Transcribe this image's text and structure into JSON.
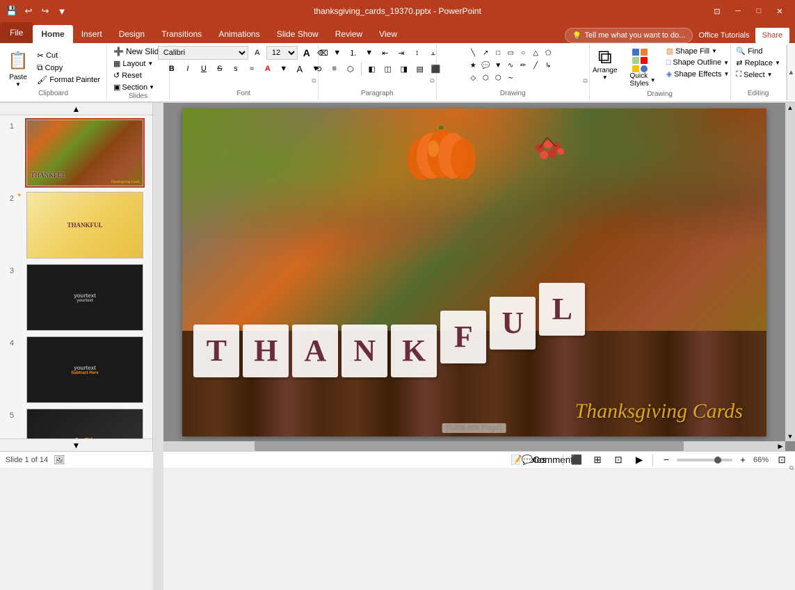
{
  "titlebar": {
    "title": "thanksgiving_cards_19370.pptx - PowerPoint",
    "qs_icons": [
      "save",
      "undo",
      "redo",
      "customize"
    ],
    "win_controls": [
      "restore",
      "minimize",
      "maximize",
      "close"
    ]
  },
  "ribbon": {
    "tabs": [
      {
        "label": "File",
        "id": "file",
        "active": false
      },
      {
        "label": "Home",
        "id": "home",
        "active": true
      },
      {
        "label": "Insert",
        "id": "insert",
        "active": false
      },
      {
        "label": "Design",
        "id": "design",
        "active": false
      },
      {
        "label": "Transitions",
        "id": "transitions",
        "active": false
      },
      {
        "label": "Animations",
        "id": "animations",
        "active": false
      },
      {
        "label": "Slide Show",
        "id": "slideshow",
        "active": false
      },
      {
        "label": "Review",
        "id": "review",
        "active": false
      },
      {
        "label": "View",
        "id": "view",
        "active": false
      }
    ],
    "tell_me_placeholder": "Tell me what you want to do...",
    "office_tutorials": "Office Tutorials",
    "share_label": "Share",
    "groups": {
      "clipboard": {
        "label": "Clipboard",
        "paste_label": "Paste",
        "cut_label": "Cut",
        "copy_label": "Copy",
        "format_painter_label": "Format Painter"
      },
      "slides": {
        "label": "Slides",
        "new_slide_label": "New Slide",
        "layout_label": "Layout",
        "reset_label": "Reset",
        "section_label": "Section"
      },
      "font": {
        "label": "Font",
        "font_name": "Calibri",
        "font_size": "12"
      },
      "paragraph": {
        "label": "Paragraph"
      },
      "drawing": {
        "label": "Drawing",
        "arrange_label": "Arrange",
        "quick_styles_label": "Quick Styles",
        "shape_fill_label": "Shape Fill",
        "shape_outline_label": "Shape Outline",
        "shape_effects_label": "Shape Effects"
      },
      "editing": {
        "label": "Editing",
        "find_label": "Find",
        "replace_label": "Replace",
        "select_label": "Select"
      }
    }
  },
  "slides": [
    {
      "num": "1",
      "star": "",
      "active": true,
      "label": "Slide 1 - Thanksgiving"
    },
    {
      "num": "2",
      "star": "★",
      "active": false,
      "label": "Slide 2"
    },
    {
      "num": "3",
      "star": "",
      "active": false,
      "label": "Slide 3"
    },
    {
      "num": "4",
      "star": "",
      "active": false,
      "label": "Slide 4"
    },
    {
      "num": "5",
      "star": "",
      "active": false,
      "label": "Slide 5"
    }
  ],
  "statusbar": {
    "slide_info": "Slide 1 of 14",
    "notes_label": "Notes",
    "comments_label": "Comments",
    "zoom_level": "66%",
    "fit_label": "Fit"
  },
  "main_slide": {
    "letters": [
      "T",
      "H",
      "A",
      "N",
      "K",
      "F",
      "U",
      "L"
    ],
    "subtitle": "Thanksgiving Cards",
    "guide_text": "{Slide title Page}"
  }
}
